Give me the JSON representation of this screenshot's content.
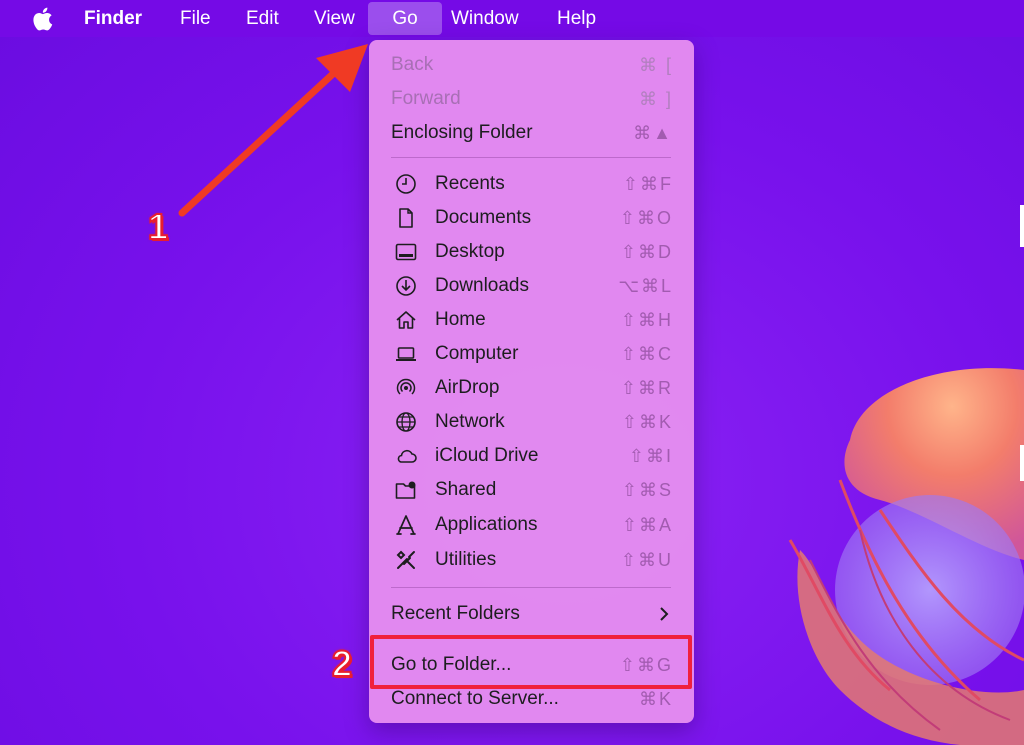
{
  "menubar": {
    "apple_icon": "apple-logo-icon",
    "items": [
      {
        "label": "Finder"
      },
      {
        "label": "File"
      },
      {
        "label": "Edit"
      },
      {
        "label": "View"
      },
      {
        "label": "Go"
      },
      {
        "label": "Window"
      },
      {
        "label": "Help"
      }
    ]
  },
  "go_menu": {
    "top_items": [
      {
        "label": "Back",
        "shortcut": "⌘ [",
        "disabled": true
      },
      {
        "label": "Forward",
        "shortcut": "⌘ ]",
        "disabled": true
      },
      {
        "label": "Enclosing Folder",
        "shortcut": "⌘▲",
        "disabled": false
      }
    ],
    "places": [
      {
        "label": "Recents",
        "shortcut": "⇧⌘F",
        "icon": "clock-icon"
      },
      {
        "label": "Documents",
        "shortcut": "⇧⌘O",
        "icon": "document-icon"
      },
      {
        "label": "Desktop",
        "shortcut": "⇧⌘D",
        "icon": "desktop-icon"
      },
      {
        "label": "Downloads",
        "shortcut": "⌥⌘L",
        "icon": "download-icon"
      },
      {
        "label": "Home",
        "shortcut": "⇧⌘H",
        "icon": "home-icon"
      },
      {
        "label": "Computer",
        "shortcut": "⇧⌘C",
        "icon": "laptop-icon"
      },
      {
        "label": "AirDrop",
        "shortcut": "⇧⌘R",
        "icon": "airdrop-icon"
      },
      {
        "label": "Network",
        "shortcut": "⇧⌘K",
        "icon": "globe-icon"
      },
      {
        "label": "iCloud Drive",
        "shortcut": "⇧⌘I",
        "icon": "cloud-icon"
      },
      {
        "label": "Shared",
        "shortcut": "⇧⌘S",
        "icon": "shared-folder-icon"
      },
      {
        "label": "Applications",
        "shortcut": "⇧⌘A",
        "icon": "applications-icon"
      },
      {
        "label": "Utilities",
        "shortcut": "⇧⌘U",
        "icon": "utilities-icon"
      }
    ],
    "recent_folders": {
      "label": "Recent Folders",
      "icon": "chevron-right-icon"
    },
    "bottom_items": [
      {
        "label": "Go to Folder...",
        "shortcut": "⇧⌘G"
      },
      {
        "label": "Connect to Server...",
        "shortcut": "⌘K"
      }
    ]
  },
  "annotations": {
    "step1": "1",
    "step2": "2",
    "arrow_color": "#f03a24",
    "highlight_color": "#f0203c"
  }
}
